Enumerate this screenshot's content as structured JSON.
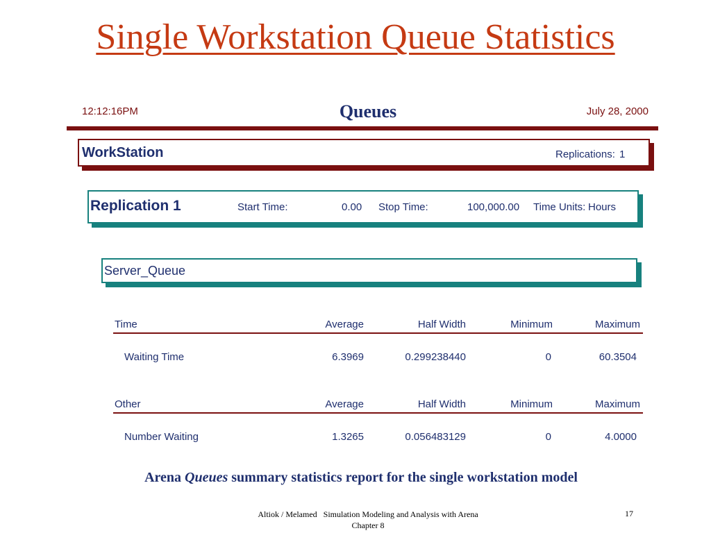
{
  "slide": {
    "title": "Single Workstation Queue Statistics"
  },
  "report": {
    "time": "12:12:16PM",
    "title": "Queues",
    "date": "July 28, 2000",
    "workstation": {
      "name": "WorkStation",
      "replications_label": "Replications:",
      "replications_value": "1"
    },
    "replication": {
      "name": "Replication 1",
      "start_label": "Start Time:",
      "start_value": "0.00",
      "stop_label": "Stop Time:",
      "stop_value": "100,000.00",
      "units_label": "Time Units:",
      "units_value": "Hours"
    },
    "queue_name": "Server_Queue",
    "time_table": {
      "headers": [
        "Time",
        "Average",
        "Half Width",
        "Minimum",
        "Maximum"
      ],
      "rows": [
        [
          "Waiting Time",
          "6.3969",
          "0.299238440",
          "0",
          "60.3504"
        ]
      ]
    },
    "other_table": {
      "headers": [
        "Other",
        "Average",
        "Half Width",
        "Minimum",
        "Maximum"
      ],
      "rows": [
        [
          "Number Waiting",
          "1.3265",
          "0.056483129",
          "0",
          "4.0000"
        ]
      ]
    }
  },
  "caption": {
    "prefix": "Arena",
    "emphasis": "Queues",
    "suffix": "summary statistics report for the single workstation model"
  },
  "footer": {
    "line1": "Altiok / Melamed   Simulation Modeling and Analysis with Arena",
    "line2": "Chapter 8",
    "page": "17"
  },
  "colors": {
    "title": "#c53a13",
    "navy": "#1f2f6e",
    "maroon": "#7a1010",
    "teal": "#17817e"
  }
}
